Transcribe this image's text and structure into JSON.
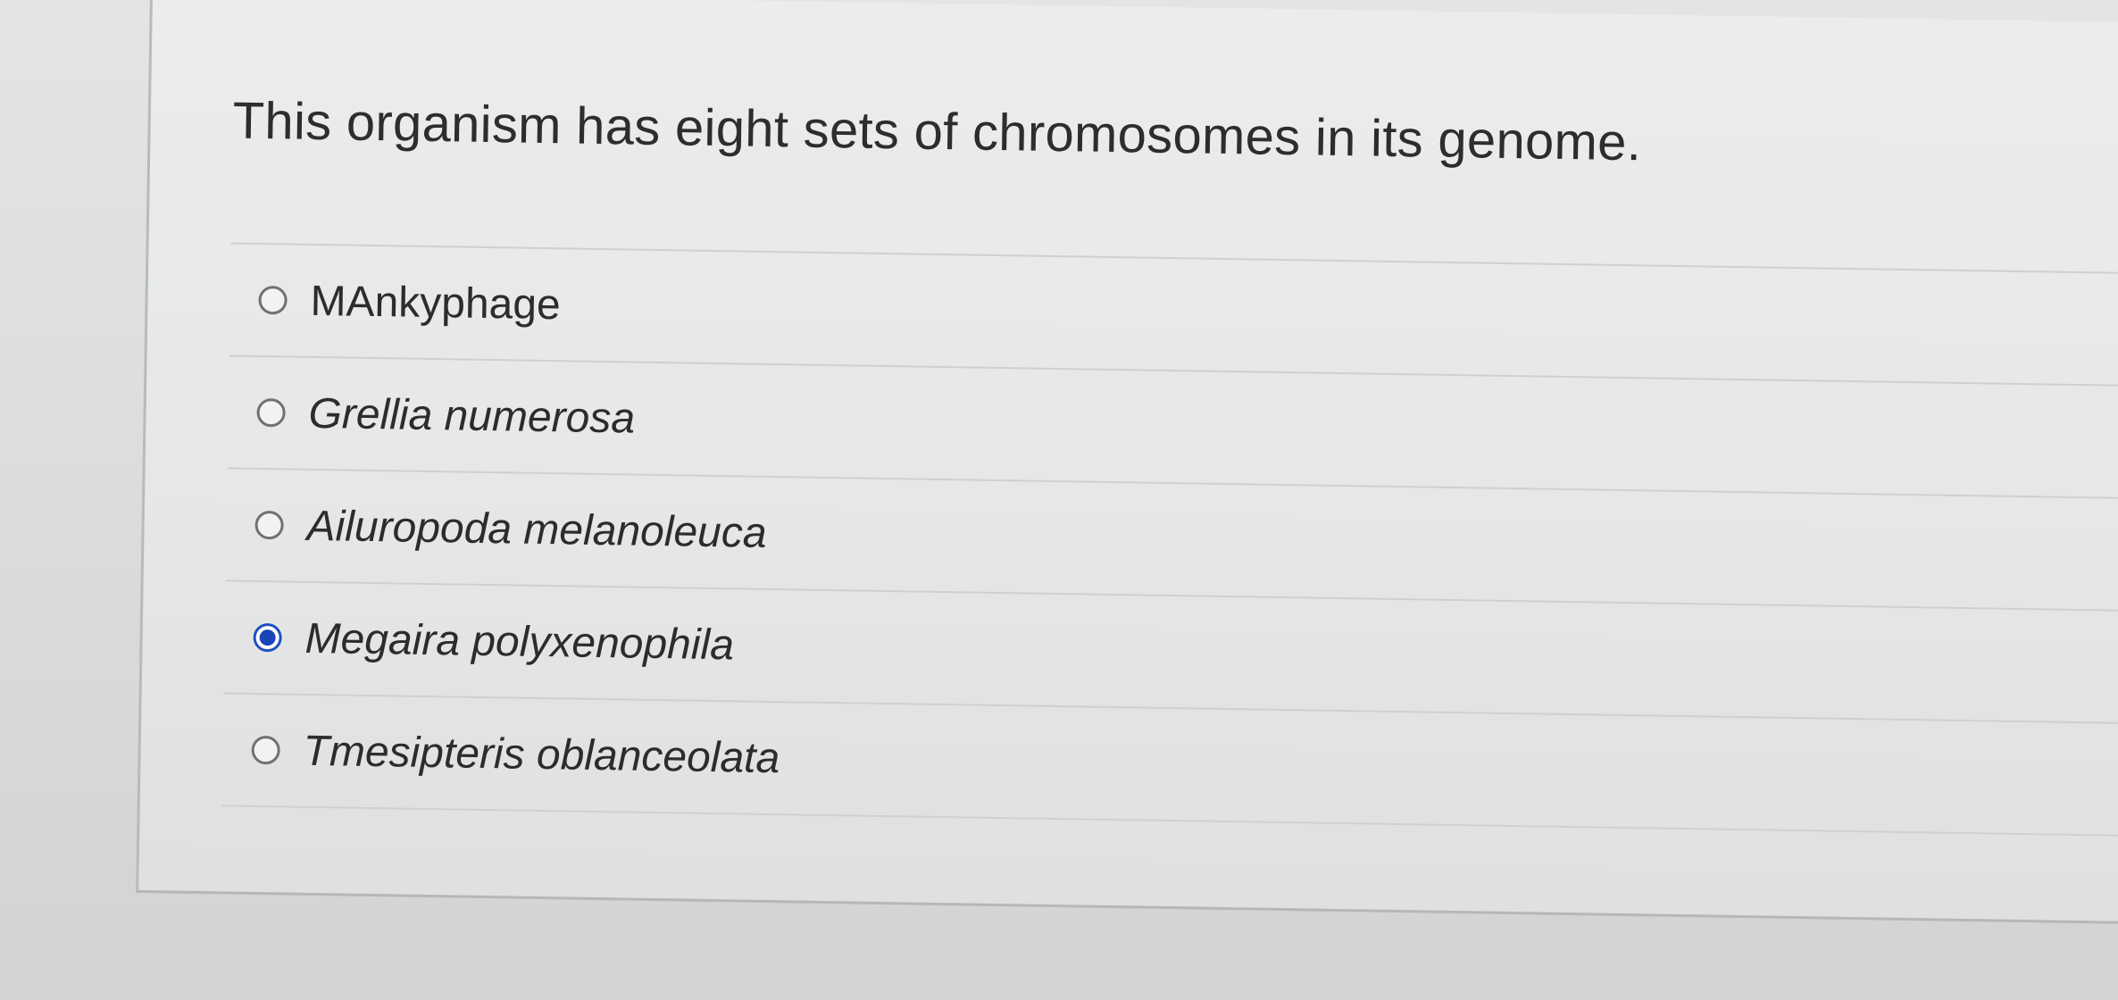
{
  "question": {
    "text": "This organism has eight sets of chromosomes in its genome."
  },
  "answers": [
    {
      "label": "MAnkyphage",
      "italic": false,
      "selected": false
    },
    {
      "label": "Grellia numerosa",
      "italic": true,
      "selected": false
    },
    {
      "label": "Ailuropoda melanoleuca",
      "italic": true,
      "selected": false
    },
    {
      "label": "Megaira polyxenophila",
      "italic": true,
      "selected": true
    },
    {
      "label": "Tmesipteris oblanceolata",
      "italic": true,
      "selected": false
    }
  ],
  "colors": {
    "accent": "#1a44b8",
    "text": "#2b2c2d",
    "background": "#e6e7e7"
  }
}
